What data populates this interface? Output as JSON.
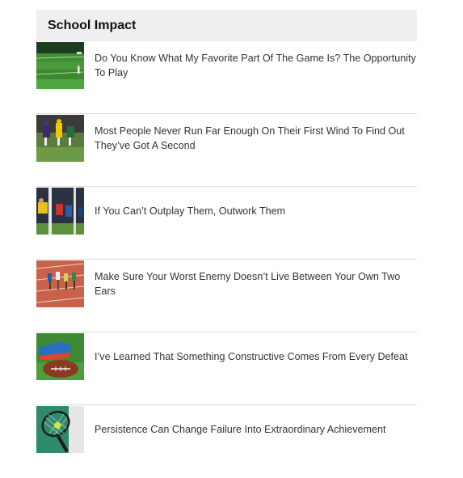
{
  "widget": {
    "title": "School Impact"
  },
  "articles": [
    {
      "title": "Do You Know What My Favorite Part Of The Game Is? The Opportunity To Play",
      "thumbnail": "football-field-photo"
    },
    {
      "title": "Most People Never Run Far Enough On Their First Wind To Find Out They’ve Got A Second",
      "thumbnail": "football-players-photo"
    },
    {
      "title": "If You Can’t Outplay Them, Outwork Them",
      "thumbnail": "goalkeeper-photo"
    },
    {
      "title": "Make Sure Your Worst Enemy Doesn’t Live Between Your Own Two Ears",
      "thumbnail": "track-runners-photo"
    },
    {
      "title": "I’ve Learned That Something Constructive Comes From Every Defeat",
      "thumbnail": "football-and-cleats-photo"
    },
    {
      "title": "Persistence Can Change Failure Into Extraordinary Achievement",
      "thumbnail": "tennis-racket-photo"
    }
  ]
}
